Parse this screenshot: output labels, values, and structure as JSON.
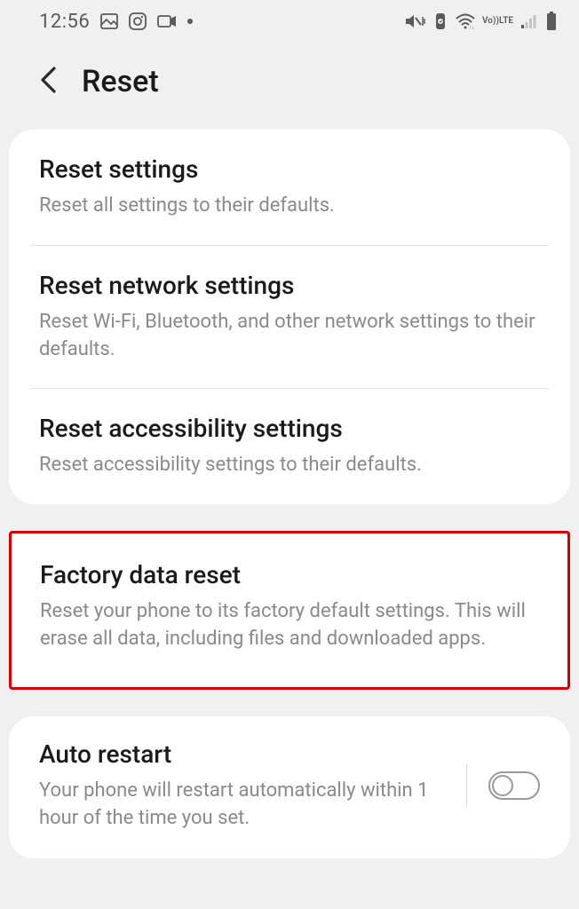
{
  "status": {
    "time": "12:56",
    "volte_top": "Vo))",
    "volte_bottom": "LTE"
  },
  "header": {
    "title": "Reset"
  },
  "group1": [
    {
      "title": "Reset settings",
      "sub": "Reset all settings to their defaults."
    },
    {
      "title": "Reset network settings",
      "sub": "Reset Wi-Fi, Bluetooth, and other network settings to their defaults."
    },
    {
      "title": "Reset accessibility settings",
      "sub": "Reset accessibility settings to their defaults."
    }
  ],
  "factory": {
    "title": "Factory data reset",
    "sub": "Reset your phone to its factory default settings. This will erase all data, including files and downloaded apps."
  },
  "auto_restart": {
    "title": "Auto restart",
    "sub": "Your phone will restart automatically within 1 hour of the time you set."
  }
}
